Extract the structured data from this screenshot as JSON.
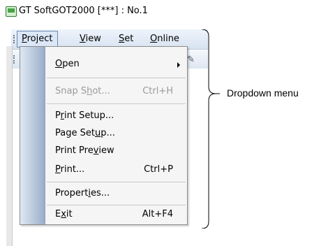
{
  "titlebar": {
    "title": "GT SoftGOT2000  [***]  : No.1"
  },
  "menubar": {
    "items": [
      {
        "label": "Project",
        "mnemonic": "P",
        "rest": "roject",
        "active": true
      },
      {
        "label": "View",
        "mnemonic": "V",
        "rest": "iew"
      },
      {
        "label": "Set",
        "mnemonic": "S",
        "rest": "et"
      },
      {
        "label": "Online",
        "mnemonic": "O",
        "rest": "nline"
      }
    ]
  },
  "dropdown": {
    "items": [
      {
        "label": "Open",
        "pre": "",
        "mn": "O",
        "post": "pen",
        "shortcut": "",
        "submenu": true
      },
      {
        "label": "Snap Shot...",
        "pre": "Snap S",
        "mn": "h",
        "post": "ot...",
        "shortcut": "Ctrl+H",
        "disabled": true
      },
      {
        "label": "Print Setup...",
        "pre": "P",
        "mn": "r",
        "post": "int Setup..."
      },
      {
        "label": "Page Setup...",
        "pre": "Page Set",
        "mn": "u",
        "post": "p..."
      },
      {
        "label": "Print Preview",
        "pre": "Print Pre",
        "mn": "v",
        "post": "iew"
      },
      {
        "label": "Print...",
        "pre": "",
        "mn": "P",
        "post": "rint...",
        "shortcut": "Ctrl+P"
      },
      {
        "label": "Properties...",
        "pre": "Propert",
        "mn": "i",
        "post": "es..."
      },
      {
        "label": "Exit",
        "pre": "E",
        "mn": "x",
        "post": "it",
        "shortcut": "Alt+F4"
      }
    ]
  },
  "annotation": {
    "label": "Dropdown menu"
  },
  "icons": {
    "app": "app-window-icon",
    "toolbar": "wrench-icon",
    "submenu": "chevron-right-icon"
  }
}
